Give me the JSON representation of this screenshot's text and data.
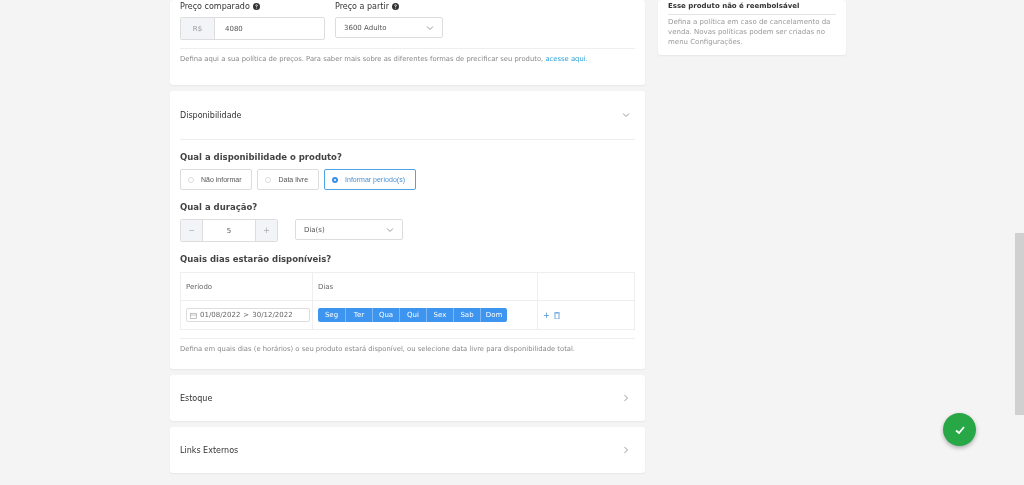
{
  "pricing": {
    "compared_label": "Preço comparado",
    "currency": "R$",
    "compared_value": "4080",
    "from_label": "Preço a partir",
    "from_value": "3600 Adulto",
    "help": "Defina aqui a sua política de preços. Para saber mais sobre as diferentes formas de precificar seu produto,",
    "help_link": "acesse aqui."
  },
  "availability": {
    "title": "Disponibilidade",
    "expanded": true,
    "question": "Qual a disponibilidade o produto?",
    "options": [
      {
        "label": "Não informar",
        "selected": false
      },
      {
        "label": "Data livre",
        "selected": false
      },
      {
        "label": "Informar período(s)",
        "selected": true
      }
    ],
    "duration_label": "Qual a duração?",
    "duration_value": "5",
    "decrement": "−",
    "increment": "+",
    "duration_unit": "Dia(s)",
    "days_label": "Quais dias estarão disponíveis?",
    "columns": [
      "Período",
      "Dias"
    ],
    "rows": [
      {
        "start": "01/08/2022",
        "arrow": ">",
        "end": "30/12/2022",
        "add": "+",
        "days": [
          {
            "label": "Seg",
            "selected": true
          },
          {
            "label": "Ter",
            "selected": true
          },
          {
            "label": "Qua",
            "selected": true
          },
          {
            "label": "Qui",
            "selected": true
          },
          {
            "label": "Sex",
            "selected": true
          },
          {
            "label": "Sab",
            "selected": true
          },
          {
            "label": "Dom",
            "selected": true
          }
        ]
      }
    ],
    "help": "Defina em quais dias (e horários) o seu produto estará disponível, ou selecione data livre para disponibilidade total."
  },
  "sections": [
    {
      "title": "Estoque",
      "expanded": false
    },
    {
      "title": "Links Externos",
      "expanded": false
    }
  ],
  "refund_card": {
    "title": "Esse produto não é reembolsável",
    "help": "Defina a política em caso de cancelamento da venda. Novas políticas podem ser criadas no menu Configurações."
  }
}
